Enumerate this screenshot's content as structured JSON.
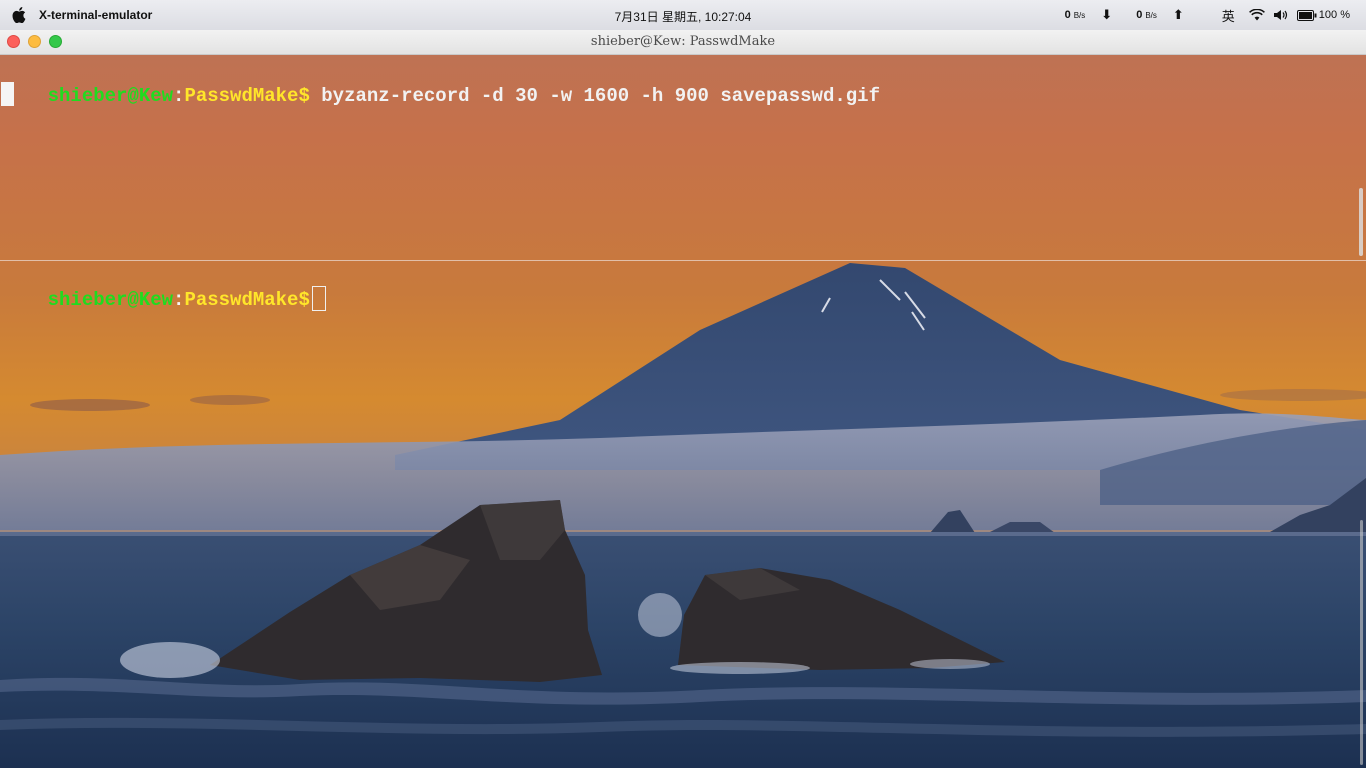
{
  "menubar": {
    "app_name": "X-terminal-emulator",
    "clock": "7月31日 星期五, 10:27:04",
    "net_down_value": "0",
    "net_down_unit": "B/s",
    "net_up_value": "0",
    "net_up_unit": "B/s",
    "down_arrow": "⬇",
    "up_arrow": "⬆",
    "input_method": "英",
    "battery_percent": "100 %",
    "icons": [
      "apple-icon",
      "download-arrow-icon",
      "upload-arrow-icon",
      "wifi-icon",
      "volume-icon",
      "battery-icon"
    ]
  },
  "window": {
    "title": "shieber@Kew: PasswdMake"
  },
  "terminal": {
    "top_pane": {
      "user_host": "shieber@Kew",
      "colon": ":",
      "path": "PasswdMake",
      "dollar": "$",
      "command": " byzanz-record -d 30 -w 1600 -h 900 savepasswd.gif"
    },
    "bottom_pane": {
      "user_host": "shieber@Kew",
      "colon": ":",
      "path": "PasswdMake",
      "dollar": "$"
    }
  },
  "colors": {
    "prompt_user": "#1fdc1f",
    "prompt_path": "#ffe62a",
    "text": "#f2f2f2"
  }
}
